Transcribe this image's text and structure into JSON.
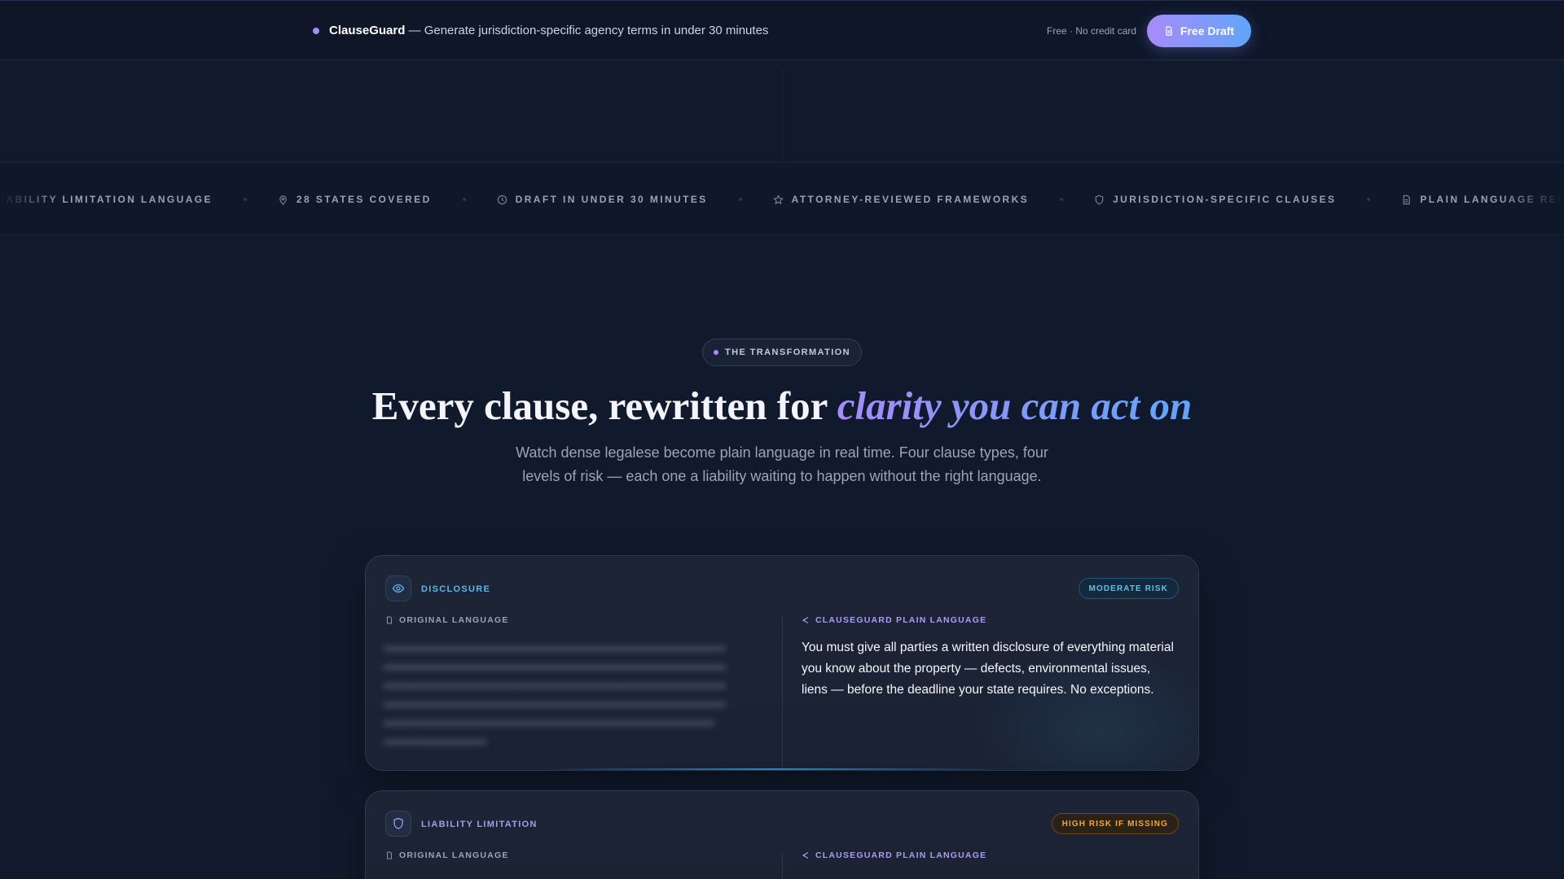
{
  "topbar": {
    "brand": "ClauseGuard",
    "tagline": " — Generate jurisdiction-specific agency terms in under 30 minutes",
    "free_note": "Free · No credit card",
    "cta_label": "Free Draft",
    "cta_icon": "document-icon",
    "accent_color": "#a78bfa",
    "cta_gradient": [
      "#a78bfa",
      "#60a5fa"
    ]
  },
  "ticker": {
    "items": [
      {
        "label": "LIABILITY LIMITATION LANGUAGE",
        "icon": "shield-icon"
      },
      {
        "label": "28 STATES COVERED",
        "icon": "map-pin-icon"
      },
      {
        "label": "DRAFT IN UNDER 30 MINUTES",
        "icon": "clock-icon"
      },
      {
        "label": "ATTORNEY-REVIEWED FRAMEWORKS",
        "icon": "star-icon"
      },
      {
        "label": "JURISDICTION-SPECIFIC CLAUSES",
        "icon": "shield-icon"
      },
      {
        "label": "PLAIN LANGUAGE REWRITES",
        "icon": "document-icon"
      }
    ]
  },
  "hero": {
    "eyebrow": "THE TRANSFORMATION",
    "headline_prefix": "Every clause, rewritten for ",
    "headline_accent": "clarity you can act on",
    "subhead": "Watch dense legalese become plain language in real time. Four clause types, four levels of risk — each one a liability waiting to happen without the right language."
  },
  "cards": [
    {
      "category": "DISCLOSURE",
      "icon": "eye-icon",
      "risk": "MODERATE RISK",
      "original_label": "ORIGINAL LANGUAGE",
      "plain_label": "CLAUSEGUARD PLAIN LANGUAGE",
      "plain_text": "You must give all parties a written disclosure of everything material you know about the property — defects, environmental issues, liens — before the deadline your state requires. No exceptions."
    },
    {
      "category": "LIABILITY LIMITATION",
      "icon": "shield-icon",
      "risk": "HIGH RISK IF MISSING",
      "original_label": "ORIGINAL LANGUAGE",
      "plain_label": "CLAUSEGUARD PLAIN LANGUAGE"
    }
  ]
}
